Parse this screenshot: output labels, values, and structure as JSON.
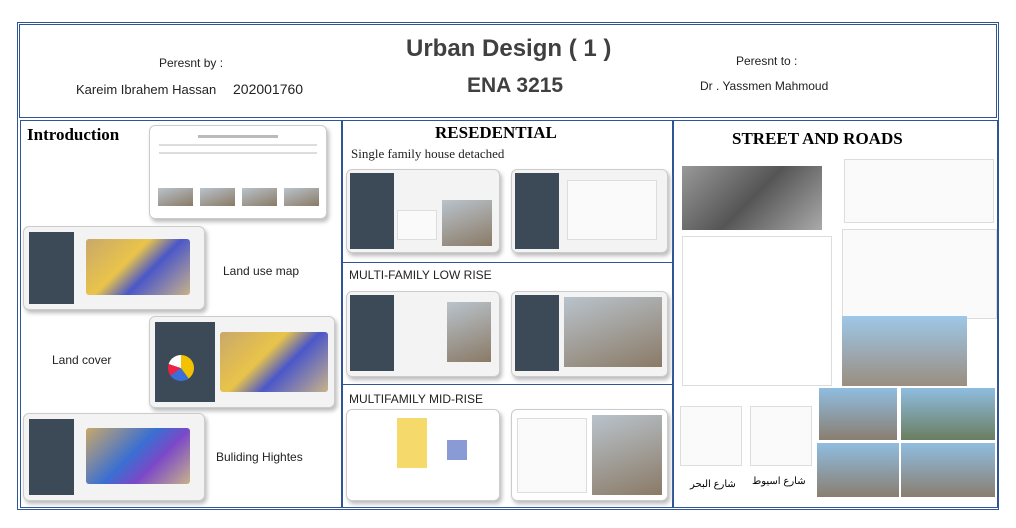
{
  "header": {
    "title": "Urban Design ( 1 )",
    "code": "ENA 3215",
    "presented_by_label": "Peresnt by :",
    "presenter": "Kareim Ibrahem Hassan",
    "student_id": "202001760",
    "presented_to_label": "Peresnt to :",
    "instructor": "Dr . Yassmen Mahmoud"
  },
  "left": {
    "title": "Introduction",
    "slides": [
      "Land use map",
      "Land cover",
      "Buliding Hightes"
    ]
  },
  "middle": {
    "title": "RESEDENTIAL",
    "sections": [
      "Single family house detached",
      "MULTI-FAMILY LOW RISE",
      "MULTIFAMILY MID-RISE"
    ]
  },
  "right": {
    "title": "STREET AND ROADS",
    "street_labels": [
      "شارع البحر",
      "شارع اسيوط"
    ]
  }
}
